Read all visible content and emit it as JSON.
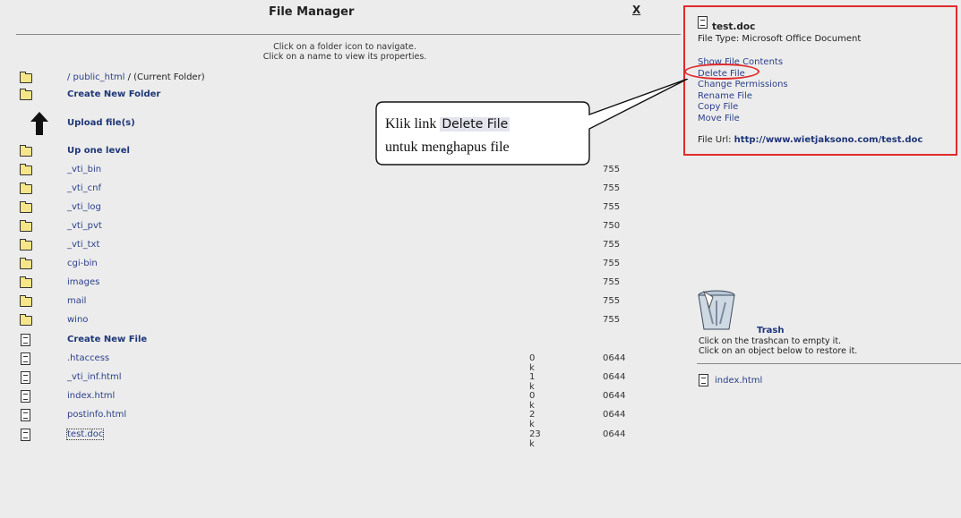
{
  "header": {
    "title": "File Manager",
    "close_label": "X"
  },
  "instructions": {
    "line1": "Click on a folder icon to navigate.",
    "line2": "Click on a name to view its properties."
  },
  "path": {
    "link": "/ public_html",
    "suffix": " / (Current Folder)"
  },
  "actions": {
    "create_folder": "Create New Folder",
    "upload": "Upload file(s)",
    "up_level": "Up one level",
    "create_file": "Create New File"
  },
  "folders": [
    {
      "name": "_vti_bin",
      "perm": "755"
    },
    {
      "name": "_vti_cnf",
      "perm": "755"
    },
    {
      "name": "_vti_log",
      "perm": "755"
    },
    {
      "name": "_vti_pvt",
      "perm": "750"
    },
    {
      "name": "_vti_txt",
      "perm": "755"
    },
    {
      "name": "cgi-bin",
      "perm": "755"
    },
    {
      "name": "images",
      "perm": "755"
    },
    {
      "name": "mail",
      "perm": "755"
    },
    {
      "name": "wino",
      "perm": "755"
    }
  ],
  "files": [
    {
      "name": ".htaccess",
      "size": "0 k",
      "perm": "0644"
    },
    {
      "name": "_vti_inf.html",
      "size": "1 k",
      "perm": "0644"
    },
    {
      "name": "index.html",
      "size": "0 k",
      "perm": "0644"
    },
    {
      "name": "postinfo.html",
      "size": "2 k",
      "perm": "0644"
    },
    {
      "name": "test.doc",
      "size": "23 k",
      "perm": "0644"
    }
  ],
  "properties": {
    "file_name": "test.doc",
    "file_type": "File Type: Microsoft Office Document",
    "links": [
      "Show File Contents",
      "Delete File",
      "Change Permissions",
      "Rename File",
      "Copy File",
      "Move File"
    ],
    "url_label": "File Url: ",
    "url_value": "http://www.wietjaksono.com/test.doc"
  },
  "callout": {
    "prefix": "Klik link ",
    "highlight": "Delete File",
    "line2": "untuk menghapus file"
  },
  "trash": {
    "title": "Trash",
    "line1": "Click on the trashcan to empty it.",
    "line2": "Click on an object below to restore it.",
    "items": [
      "index.html"
    ]
  },
  "colors": {
    "background": "#ececec",
    "link": "#2a3f8a",
    "highlight_border": "#e02b2b"
  }
}
